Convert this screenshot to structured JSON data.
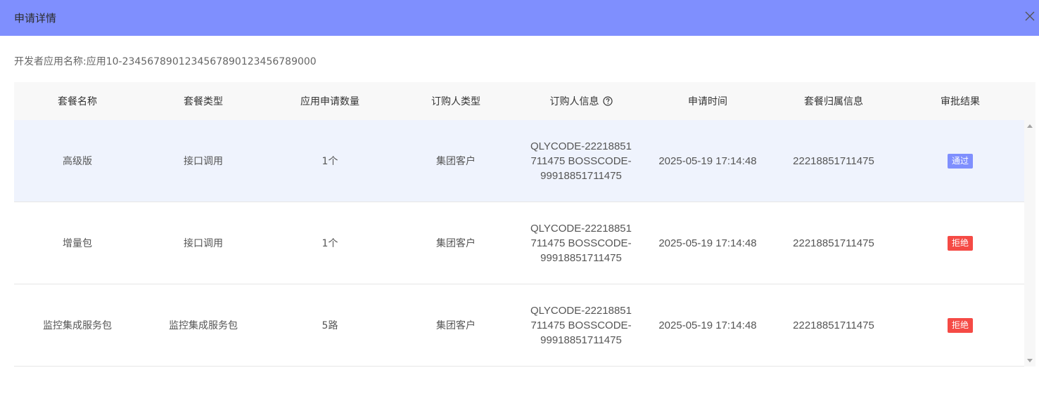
{
  "dialog": {
    "title": "申请详情",
    "close_icon": "close-icon",
    "header_color": "#7f8ffe"
  },
  "app": {
    "label": "开发者应用名称:应用10-2345678901234567890123456789000"
  },
  "table": {
    "columns": [
      "套餐名称",
      "套餐类型",
      "应用申请数量",
      "订购人类型",
      "订购人信息",
      "申请时间",
      "套餐归属信息",
      "审批结果"
    ],
    "help_icon": "question-circle-icon",
    "rows": [
      {
        "package_name": "高级版",
        "package_type": "接口调用",
        "quantity": "1个",
        "orderer_type": "集团客户",
        "orderer_info": "QLYCODE-22218851711475 BOSSCODE-99918851711475",
        "apply_time": "2025-05-19 17:14:48",
        "ownership": "22218851711475",
        "result": "通过",
        "result_color": "#7f8ffe"
      },
      {
        "package_name": "增量包",
        "package_type": "接口调用",
        "quantity": "1个",
        "orderer_type": "集团客户",
        "orderer_info": "QLYCODE-22218851711475 BOSSCODE-99918851711475",
        "apply_time": "2025-05-19 17:14:48",
        "ownership": "22218851711475",
        "result": "拒绝",
        "result_color": "#f54a45"
      },
      {
        "package_name": "监控集成服务包",
        "package_type": "监控集成服务包",
        "quantity": "5路",
        "orderer_type": "集团客户",
        "orderer_info": "QLYCODE-22218851711475 BOSSCODE-99918851711475",
        "apply_time": "2025-05-19 17:14:48",
        "ownership": "22218851711475",
        "result": "拒绝",
        "result_color": "#f54a45"
      }
    ]
  }
}
